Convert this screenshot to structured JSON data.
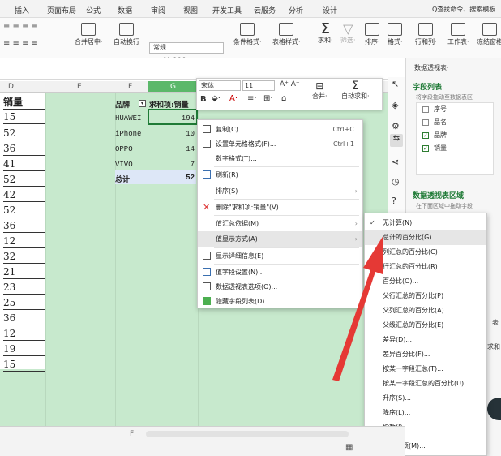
{
  "ribbon_tabs": [
    "插入",
    "页面布局",
    "公式",
    "数据",
    "审阅",
    "视图",
    "开发工具",
    "云服务",
    "分析",
    "设计"
  ],
  "search_hint": "Q查找命令、搜索模板",
  "ribbon": {
    "merge": "合并居中·",
    "wrap": "自动换行",
    "format_select": "常规",
    "pct": "%",
    "thousand": "000",
    "cond": "条件格式·",
    "table_style": "表格样式·",
    "sum": "求和·",
    "filter": "筛选·",
    "sort": "排序·",
    "format": "格式·",
    "rowcol": "行和列·",
    "sheet": "工作表·",
    "freeze": "冻结窗格"
  },
  "col_headers": [
    "D",
    "E",
    "F",
    "G"
  ],
  "col_a": [
    "销量",
    "15",
    "52",
    "36",
    "41",
    "52",
    "42",
    "52",
    "36",
    "12",
    "32",
    "21",
    "23",
    "25",
    "36",
    "12",
    "19",
    "15"
  ],
  "pivot": {
    "h_brand": "品牌",
    "h_sum": "求和项:销量",
    "rows": [
      {
        "b": "HUAWEI",
        "v": "194"
      },
      {
        "b": "iPhone",
        "v": "10"
      },
      {
        "b": "OPPO",
        "v": "14"
      },
      {
        "b": "VIVO",
        "v": "7"
      }
    ],
    "total_label": "总计",
    "total_val": "52"
  },
  "mini": {
    "font": "宋体",
    "size": "11",
    "merge": "合并·",
    "autosum": "自动求和·"
  },
  "menu": {
    "copy": "复制(C)",
    "copy_key": "Ctrl+C",
    "fmt_cells": "设置单元格格式(F)...",
    "fmt_key": "Ctrl+1",
    "num_fmt": "数字格式(T)...",
    "refresh": "刷新(R)",
    "sort": "排序(S)",
    "delete": "删除\"求和项:销量\"(V)",
    "summarize": "值汇总依据(M)",
    "show_as": "值显示方式(A)",
    "details": "显示详细信息(E)",
    "field_settings": "值字段设置(N)...",
    "pt_options": "数据透视表选项(O)...",
    "hide_list": "隐藏字段列表(D)"
  },
  "submenu": [
    "无计算(N)",
    "总计的百分比(G)",
    "列汇总的百分比(C)",
    "行汇总的百分比(R)",
    "百分比(O)...",
    "父行汇总的百分比(P)",
    "父列汇总的百分比(A)",
    "父级汇总的百分比(E)",
    "差异(D)...",
    "差异百分比(F)...",
    "按某一字段汇总(T)...",
    "按某一字段汇总的百分比(U)...",
    "升序(S)...",
    "降序(L)...",
    "指数(I)",
    "其他选项(M)..."
  ],
  "pane": {
    "title": "数据透视表·",
    "field_list": "字段列表",
    "drag_hint": "将字段拖动至数据表区",
    "fields": [
      {
        "name": "序号",
        "on": false
      },
      {
        "name": "品名",
        "on": false
      },
      {
        "name": "品牌",
        "on": true
      },
      {
        "name": "销量",
        "on": true
      }
    ],
    "area_title": "数据透视表区域",
    "area_hint": "在下面区域中拖动字段",
    "frag1": "表",
    "frag2": "求和"
  },
  "sheet_tab": "F",
  "colors": {
    "grid": "#c7e9cd",
    "accent": "#1f7a36",
    "arrow": "#e53935",
    "header_sel": "#5bb86a"
  }
}
